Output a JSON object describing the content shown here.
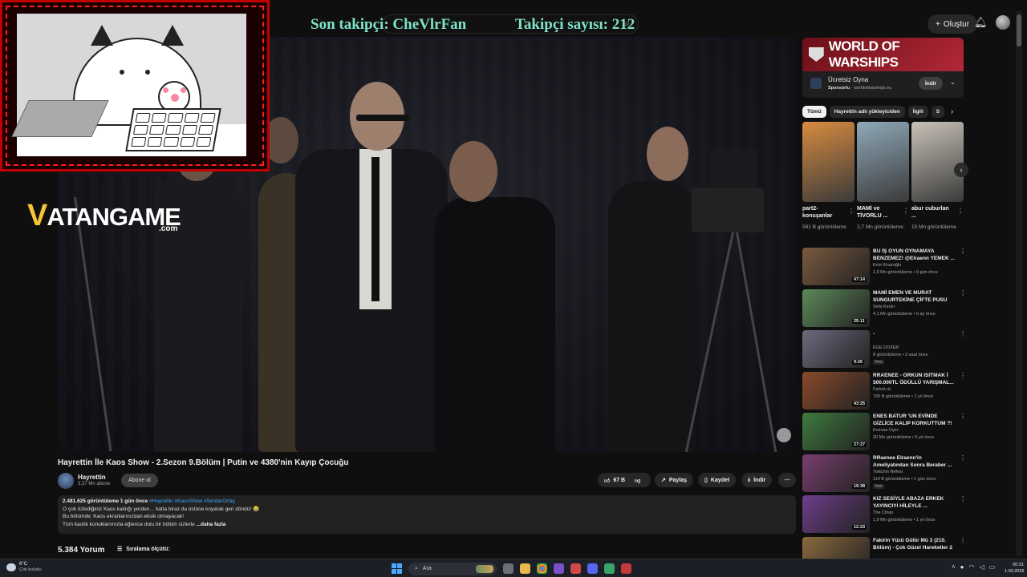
{
  "overlay": {
    "last_follower": "Son takipçi: CheVlrFan",
    "follower_count": "Takipçi sayısı: 212"
  },
  "logo": {
    "main": "ATANGAME",
    "v": "V",
    "sub": ".com"
  },
  "header": {
    "create_label": "Oluştur"
  },
  "video": {
    "title": "Hayrettin İle Kaos Show - 2.Sezon 9.Bölüm | Putin ve 4380'nin Kayıp Çocuğu",
    "channel_name": "Hayrettin",
    "channel_subs": "3,37 Mn abone",
    "subscribe_label": "Abone ol",
    "like_count": "67 B",
    "share_label": "Paylaş",
    "save_label": "Kaydet",
    "download_label": "İndir",
    "views_date": "2.481.625 görüntüleme  1 gün önce",
    "tags": "#Hayrettin #KaosShow #SerdarOrtaç",
    "desc_line1": "O çok özlediğiniz Kaos kaldığı yerden... hatta biraz da üstüne koyarak geri döndü! 😂",
    "desc_line2": "Bu bölümde; Kaos ekranlarınızdan eksik olmayacak!",
    "desc_line3": "Tüm kaotik konuklarımızla eğlence dolu bir bölüm sizlerle",
    "more_label": "...daha fazla",
    "comments_count": "5.384 Yorum",
    "sort_label": "Sıralama ölçütü:"
  },
  "ad": {
    "banner": "WORLD OF WARSHIPS",
    "title": "Ücretsiz Oyna",
    "sponsor": "Sponsorlu",
    "domain": "· worldofwarships.eu",
    "button": "İndir"
  },
  "chips": [
    "Tümü",
    "Hayrettin adlı yükleyiciden",
    "İlgili",
    "S"
  ],
  "shorts": [
    {
      "title": "part2-konuşanlar",
      "views": "581 B görüntüleme",
      "color": "#d88b3f"
    },
    {
      "title": "MAMİ ve TİVORLU ...",
      "views": "2,7 Mn görüntüleme",
      "color": "#8fa8b8"
    },
    {
      "title": "abur cuburlan ...",
      "views": "15 Mn görüntüleme",
      "color": "#c9c2b8"
    }
  ],
  "recommendations": [
    {
      "title": "BU İŞ OYUN OYNAMAYA BENZEMEZ! @Elraenn YEMEK ...",
      "channel": "Enis Kirazoğlu",
      "meta": "1,9 Mn görüntüleme • 9 gün önce",
      "duration": "47:14",
      "new": "",
      "color": "#7a5a3e"
    },
    {
      "title": "MAMİ EMEN VE MURAT SUNGURTEKİNE ÇİFTE PUSU",
      "channel": "Sefa Kındır",
      "meta": "4,1 Mn görüntüleme • 6 ay önce",
      "duration": "25:11",
      "new": "",
      "color": "#5d8a5a"
    },
    {
      "title": "-",
      "channel": "EGE DOZER",
      "meta": "8 görüntüleme • 3 saat önce",
      "duration": "9:26",
      "new": "Yeni",
      "color": "#6d6a7e"
    },
    {
      "title": "RRAENEE - ORKUN ISITMAK İ 500.000TL ÖDÜLLÜ YARIŞMAL...",
      "channel": "FarkoLoL",
      "meta": "700 B görüntüleme • 1 yıl önce",
      "duration": "43:25",
      "new": "",
      "color": "#8a4a2a"
    },
    {
      "title": "ENES BATUR 'UN EVİNDE GİZLİCE KALIP KORKUTTUM ?!",
      "channel": "Ecenaz Üçer",
      "meta": "20 Mn görüntüleme • 5 yıl önce",
      "duration": "27:27",
      "new": "",
      "color": "#3e7a3e"
    },
    {
      "title": "RRaenee Elraenn'in Ameliyatından Sonra Beraber ...",
      "channel": "Twitchin Nefesi",
      "meta": "110 B görüntüleme • 1 gün önce",
      "duration": "19:38",
      "new": "Yeni",
      "color": "#7a3e6e"
    },
    {
      "title": "KIZ SESİYLE ABAZA ERKEK YAYINCIYI HİLEYLE ...",
      "channel": "The Cihan",
      "meta": "1,9 Mn görüntüleme • 1 yıl önce",
      "duration": "12:23",
      "new": "",
      "color": "#6e3e8a"
    },
    {
      "title": "Fakirin Yüzü Gülür Mü 3 (210. Bölüm) - Çok Güzel Hareketler 2",
      "channel": "",
      "meta": "",
      "duration": "",
      "new": "",
      "color": "#8a6a3e"
    }
  ],
  "taskbar": {
    "temp": "6°C",
    "condition": "Çok bulutlu",
    "search": "Ara",
    "time": "00:31",
    "date": "1.03.2026"
  }
}
